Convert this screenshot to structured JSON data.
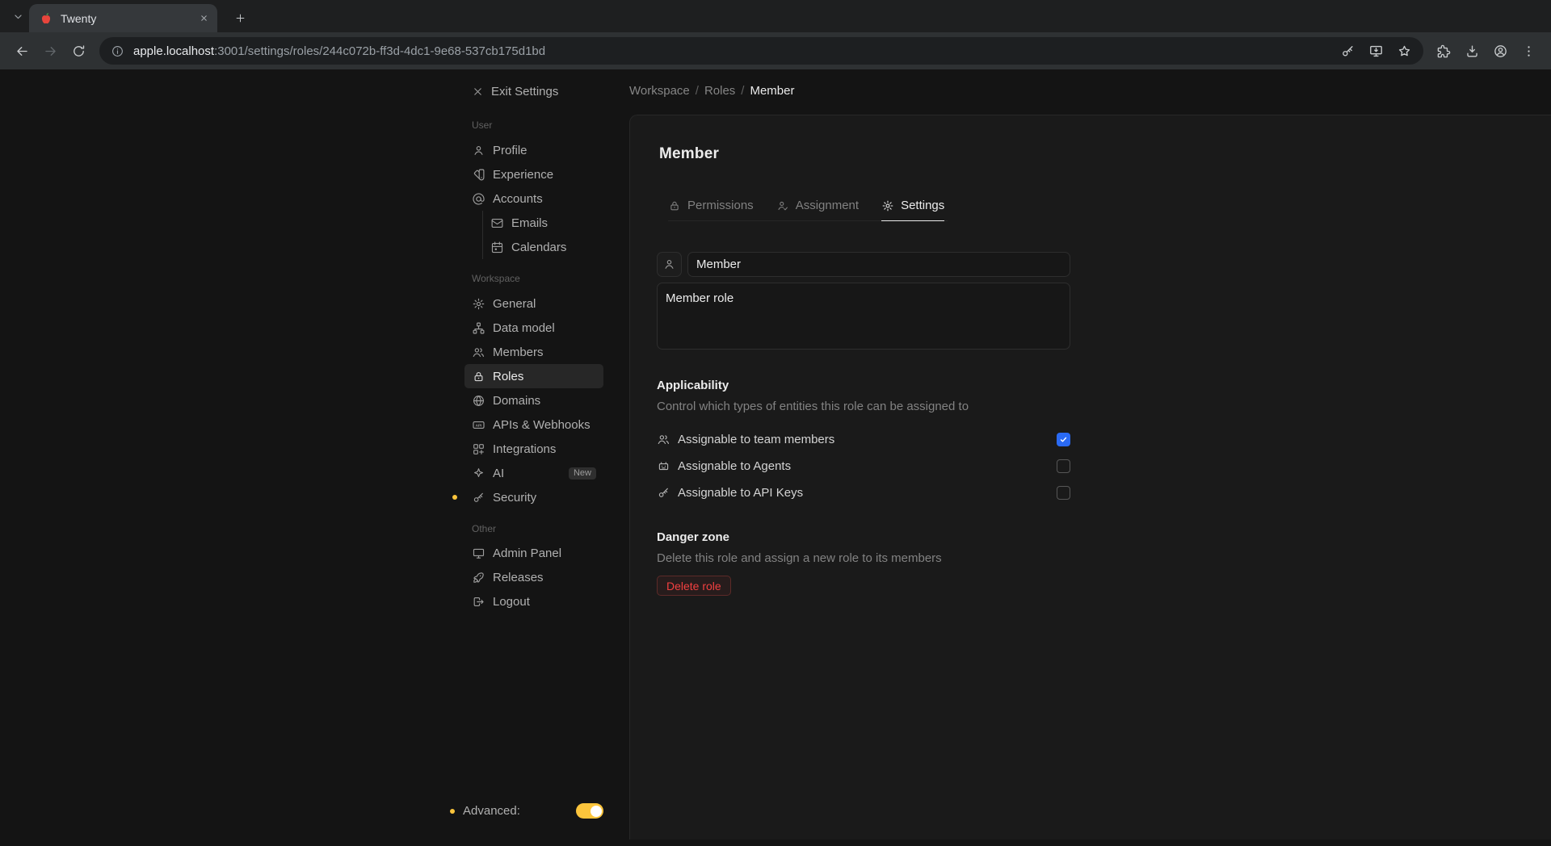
{
  "browser": {
    "tab": {
      "title": "Twenty",
      "favicon": "apple-icon"
    },
    "url": {
      "domain": "apple.localhost",
      "path": ":3001/settings/roles/244c072b-ff3d-4dc1-9e68-537cb175d1bd"
    },
    "toolbar_icons": [
      "back-icon",
      "forward-icon",
      "reload-icon",
      "site-info-icon",
      "password-key-icon",
      "install-app-icon",
      "bookmark-star-icon",
      "extensions-puzzle-icon",
      "download-icon",
      "profile-avatar-icon",
      "kebab-menu-icon"
    ]
  },
  "sidebar": {
    "exit_label": "Exit Settings",
    "sections": [
      {
        "label": "User",
        "items": [
          {
            "label": "Profile",
            "icon": "user-icon"
          },
          {
            "label": "Experience",
            "icon": "color-swatch-icon"
          },
          {
            "label": "Accounts",
            "icon": "at-icon",
            "children": [
              {
                "label": "Emails",
                "icon": "mail-icon"
              },
              {
                "label": "Calendars",
                "icon": "calendar-icon"
              }
            ]
          }
        ]
      },
      {
        "label": "Workspace",
        "items": [
          {
            "label": "General",
            "icon": "gear-icon"
          },
          {
            "label": "Data model",
            "icon": "hierarchy-icon"
          },
          {
            "label": "Members",
            "icon": "users-icon"
          },
          {
            "label": "Roles",
            "icon": "lock-icon",
            "selected": true
          },
          {
            "label": "Domains",
            "icon": "globe-icon"
          },
          {
            "label": "APIs & Webhooks",
            "icon": "api-icon"
          },
          {
            "label": "Integrations",
            "icon": "apps-icon"
          },
          {
            "label": "AI",
            "icon": "sparkles-icon",
            "badge": "New"
          },
          {
            "label": "Security",
            "icon": "key-icon",
            "advanced_dot": true
          }
        ]
      },
      {
        "label": "Other",
        "items": [
          {
            "label": "Admin Panel",
            "icon": "monitor-icon"
          },
          {
            "label": "Releases",
            "icon": "rocket-icon"
          },
          {
            "label": "Logout",
            "icon": "logout-icon"
          }
        ]
      }
    ],
    "advanced": {
      "label": "Advanced:",
      "enabled": true
    }
  },
  "breadcrumb": {
    "items": [
      "Workspace",
      "Roles"
    ],
    "separator": "/",
    "current": "Member"
  },
  "main": {
    "title": "Member",
    "tabs": [
      {
        "label": "Permissions",
        "icon": "lock-icon"
      },
      {
        "label": "Assignment",
        "icon": "user-check-icon"
      },
      {
        "label": "Settings",
        "icon": "gear-icon",
        "active": true
      }
    ],
    "name_input": {
      "value": "Member",
      "icon": "user-icon"
    },
    "description_input": {
      "value": "Member role"
    },
    "applicability": {
      "title": "Applicability",
      "subtitle": "Control which types of entities this role can be assigned to",
      "options": [
        {
          "label": "Assignable to team members",
          "icon": "users-icon",
          "checked": true
        },
        {
          "label": "Assignable to Agents",
          "icon": "robot-icon",
          "checked": false
        },
        {
          "label": "Assignable to API Keys",
          "icon": "key-icon",
          "checked": false
        }
      ]
    },
    "danger_zone": {
      "title": "Danger zone",
      "subtitle": "Delete this role and assign a new role to its members",
      "button_label": "Delete role"
    }
  },
  "colors": {
    "app_bg": "#141414",
    "panel_bg": "#1a1a1a",
    "accent_blue": "#2a6af3",
    "accent_yellow": "#fcc53c",
    "danger_red": "#f24040"
  }
}
